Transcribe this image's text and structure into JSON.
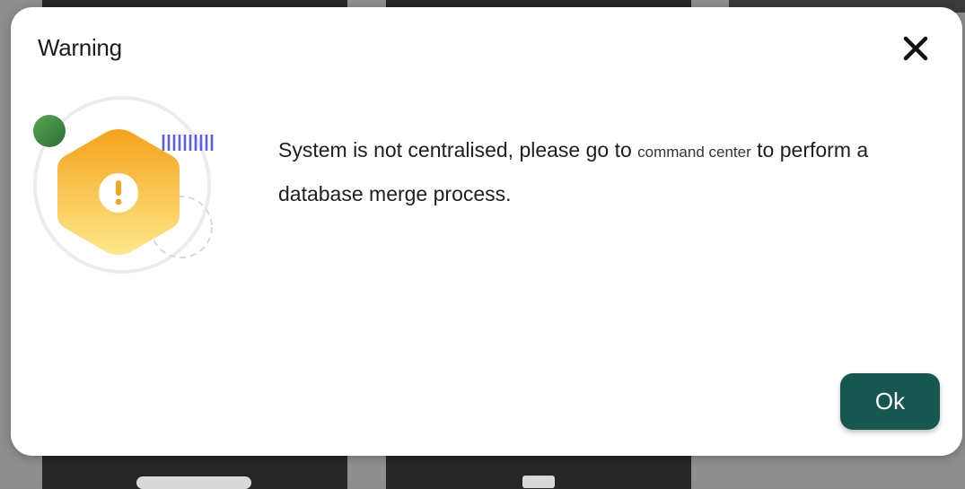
{
  "dialog": {
    "title": "Warning",
    "close_icon": "close-icon",
    "illustration_icon": "warning-hexagon-icon",
    "message": {
      "part1": "System is not centralised, please go to ",
      "link": "command center",
      "part2": " to perform a database merge process."
    },
    "ok_label": "Ok"
  },
  "colors": {
    "ok_button": "#16574f",
    "hexagon": "#f7b22a",
    "green_dot": "#3f8f3f",
    "stripes": "#5b5bf0"
  }
}
